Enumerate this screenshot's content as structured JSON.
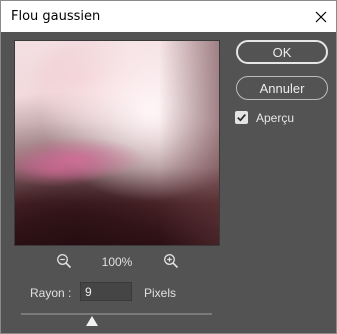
{
  "window": {
    "title": "Flou gaussien"
  },
  "buttons": {
    "ok_label": "OK",
    "cancel_label": "Annuler"
  },
  "preview_option": {
    "label": "Aperçu",
    "checked": true
  },
  "zoom": {
    "level": "100%"
  },
  "radius": {
    "label": "Rayon :",
    "value": "9",
    "unit": "Pixels"
  },
  "slider": {
    "value": 0.37
  },
  "icons": {
    "close": "close-icon",
    "zoom_out": "zoom-out-icon",
    "zoom_in": "zoom-in-icon",
    "check": "checkmark-icon"
  }
}
